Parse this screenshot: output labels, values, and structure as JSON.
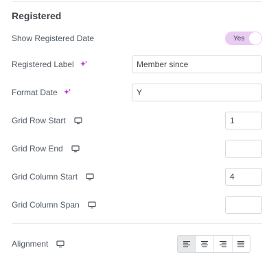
{
  "section": {
    "title": "Registered"
  },
  "fields": {
    "show_date": {
      "label": "Show Registered Date",
      "toggle_label": "Yes"
    },
    "registered_label": {
      "label": "Registered Label",
      "value": "Member since"
    },
    "format_date": {
      "label": "Format Date",
      "value": "Y"
    },
    "grid_row_start": {
      "label": "Grid Row Start",
      "value": "1"
    },
    "grid_row_end": {
      "label": "Grid Row End",
      "value": ""
    },
    "grid_column_start": {
      "label": "Grid Column Start",
      "value": "4"
    },
    "grid_column_span": {
      "label": "Grid Column Span",
      "value": ""
    }
  },
  "alignment": {
    "label": "Alignment",
    "options": [
      "left",
      "center",
      "right",
      "justify"
    ],
    "selected": "left"
  },
  "icons": {
    "dynamic_tag": "ai-sparkle-icon",
    "responsive": "desktop-monitor-icon"
  },
  "colors": {
    "accent": "#b238c9",
    "toggle_bg": "#eacbf1",
    "border": "#d5d8dc",
    "text": "#3f444b"
  }
}
